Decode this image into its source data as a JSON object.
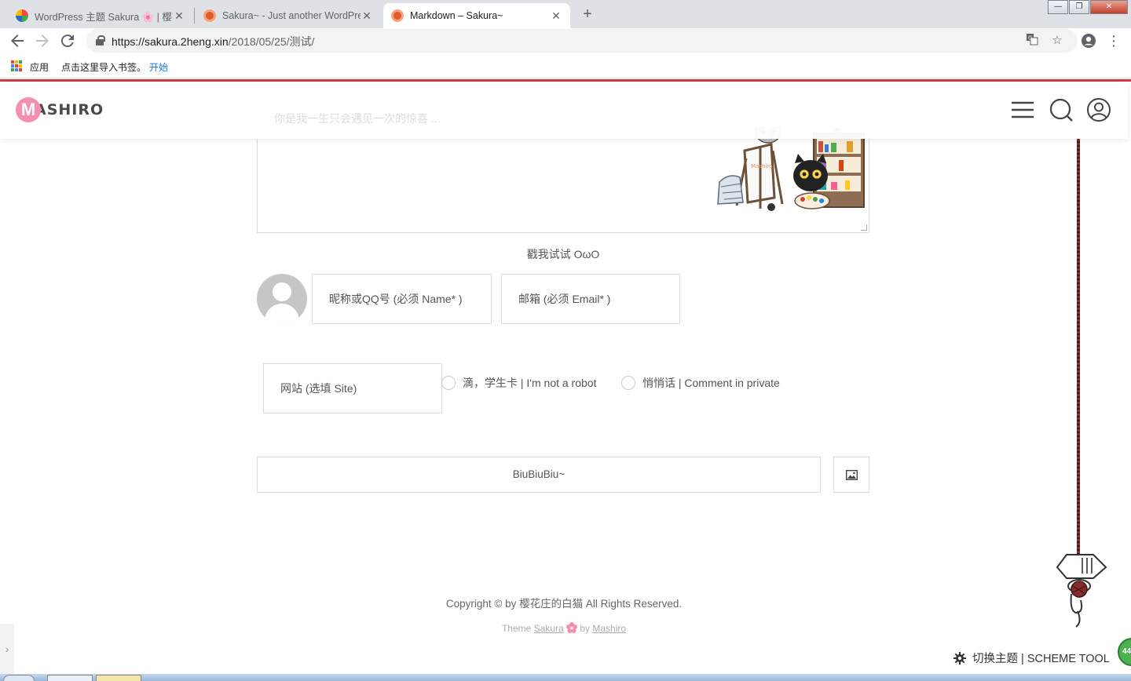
{
  "browser": {
    "tabs": [
      {
        "title": "WordPress 主题 Sakura 🌸 | 樱花",
        "active": false
      },
      {
        "title": "Sakura~ - Just another WordPress",
        "active": false
      },
      {
        "title": "Markdown – Sakura~",
        "active": true
      }
    ],
    "new_tab_label": "+",
    "close_glyph": "✕",
    "window_controls": {
      "minimize": "—",
      "maximize": "❐",
      "close": "✕"
    },
    "url_host": "https://sakura.2heng.xin",
    "url_path": "/2018/05/25/测试/",
    "bookmarks": {
      "apps_label": "应用",
      "import_text": "点击这里导入书签。",
      "start_link": "开始"
    },
    "icons": [
      "back-icon",
      "forward-icon",
      "reload-icon",
      "lock-icon",
      "translate-icon",
      "star-icon",
      "account-icon",
      "menu-dots-icon"
    ]
  },
  "site": {
    "logo_badge": "M",
    "logo_text": "ASHIRO",
    "comment_placeholder": "你是我一生只会遇见一次的惊喜 ...",
    "emote_trigger": "戳我试试 OωO",
    "fields": {
      "name_placeholder": "昵称或QQ号 (必须 Name* )",
      "email_placeholder": "邮箱 (必须 Email* )",
      "site_placeholder": "网站 (选填 Site)"
    },
    "checks": {
      "robot": "滴，学生卡 | I'm not a robot",
      "private": "悄悄话 | Comment in private"
    },
    "submit_label": "BiuBiuBiu~",
    "footer": {
      "copyright": "Copyright © by 樱花庄的白猫 All Rights Reserved.",
      "theme_prefix": "Theme ",
      "theme_name": "Sakura",
      "by": " by ",
      "author": "Mashiro"
    },
    "scheme_tool": "切换主题 | SCHEME TOOL",
    "badge_count": "44",
    "left_tab_glyph": "›",
    "colors": {
      "accent_red": "#d13b3b",
      "logo_pink": "#f48fb1",
      "badge_green": "#4caf50"
    }
  }
}
